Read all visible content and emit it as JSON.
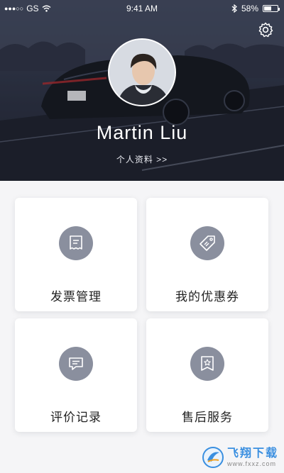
{
  "status_bar": {
    "carrier": "GS",
    "time": "9:41 AM",
    "battery": "58%",
    "battery_level": 0.58
  },
  "profile": {
    "name": "Martin Liu",
    "profile_link": "个人资料 >>"
  },
  "icons": {
    "settings": "gear-icon",
    "wifi": "wifi-icon",
    "bluetooth": "bluetooth-icon"
  },
  "cards": [
    {
      "label": "发票管理",
      "icon": "invoice-icon"
    },
    {
      "label": "我的优惠券",
      "icon": "coupon-tag-icon"
    },
    {
      "label": "评价记录",
      "icon": "comment-icon"
    },
    {
      "label": "售后服务",
      "icon": "service-badge-icon"
    }
  ],
  "watermark": {
    "title": "飞翔下载",
    "url": "www.fxxz.com"
  },
  "colors": {
    "header_bg": "#2a2f3e",
    "icon_circle": "#8a8f9e",
    "card_bg": "#ffffff",
    "page_bg": "#f5f5f7",
    "watermark": "#3a8fe0"
  }
}
